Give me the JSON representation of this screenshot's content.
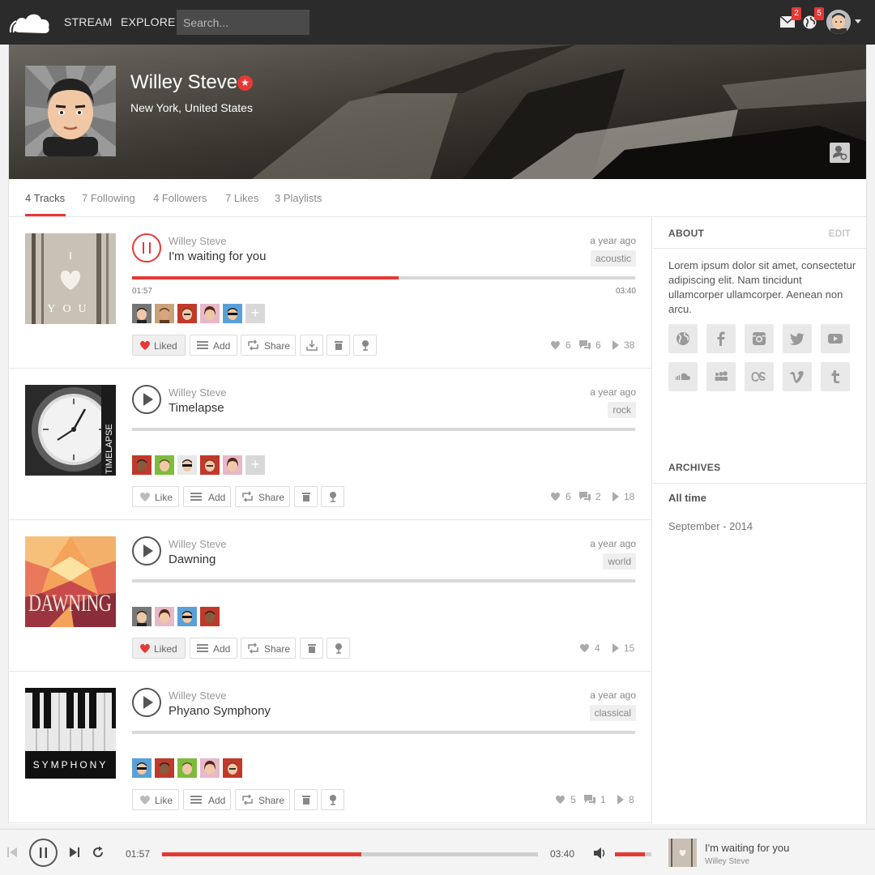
{
  "topbar": {
    "nav": [
      "STREAM",
      "EXPLORE"
    ],
    "search_placeholder": "Search...",
    "messages_count": "2",
    "notifications_count": "5"
  },
  "profile": {
    "name": "Willey Steve",
    "location": "New York, United States",
    "pro_badge": "★"
  },
  "tabs": [
    "4 Tracks",
    "7 Following",
    "4 Followers",
    "7 Likes",
    "3 Playlists"
  ],
  "tracks": [
    {
      "user": "Willey Steve",
      "title": "I'm waiting for you",
      "time": "a year ago",
      "tag": "acoustic",
      "art_text": "I YOU",
      "current": "01:57",
      "duration": "03:40",
      "progress": 0.53,
      "like_label": "Liked",
      "add_label": "Add",
      "share_label": "Share",
      "likes": "6",
      "comments": "6",
      "plays": "38"
    },
    {
      "user": "Willey Steve",
      "title": "Timelapse",
      "time": "a year ago",
      "tag": "rock",
      "art_text": "TIMELAPSE",
      "like_label": "Like",
      "add_label": "Add",
      "share_label": "Share",
      "likes": "6",
      "comments": "2",
      "plays": "18"
    },
    {
      "user": "Willey Steve",
      "title": "Dawning",
      "time": "a year ago",
      "tag": "world",
      "art_text": "DAWNING",
      "like_label": "Liked",
      "add_label": "Add",
      "share_label": "Share",
      "likes": "4",
      "plays": "15"
    },
    {
      "user": "Willey Steve",
      "title": "Phyano Symphony",
      "time": "a year ago",
      "tag": "classical",
      "art_text": "SYMPHONY",
      "like_label": "Like",
      "add_label": "Add",
      "share_label": "Share",
      "likes": "5",
      "comments": "1",
      "plays": "8"
    }
  ],
  "sidebar": {
    "about_heading": "ABOUT",
    "edit_label": "EDIT",
    "about_text": "Lorem ipsum dolor sit amet, consectetur adipiscing elit. Nam tincidunt ullamcorper ullamcorper. Aenean non arcu.",
    "social_icons": [
      "globe-icon",
      "facebook-icon",
      "instagram-icon",
      "twitter-icon",
      "youtube-icon",
      "soundcloud-icon",
      "myspace-icon",
      "lastfm-icon",
      "vimeo-icon",
      "tumblr-icon"
    ],
    "archives_heading": "ARCHIVES",
    "archives": [
      "All time",
      "September - 2014"
    ]
  },
  "player": {
    "current": "01:57",
    "duration": "03:40",
    "progress": 0.53,
    "volume": 0.82,
    "title": "I'm waiting for you",
    "user": "Willey Steve"
  },
  "colors": {
    "accent": "#e53935",
    "topbar": "#2b2b2b"
  }
}
